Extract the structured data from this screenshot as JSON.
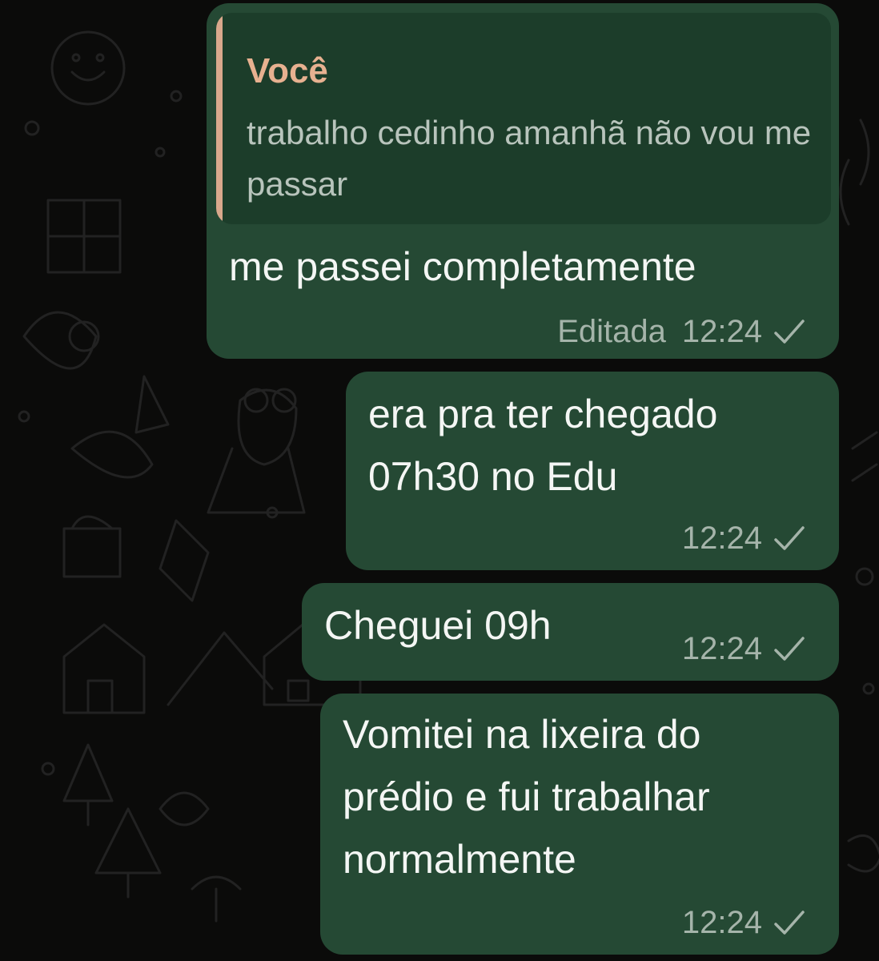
{
  "colors": {
    "background": "#0b0b0a",
    "bubble_outgoing": "#254934",
    "quote_background": "#1c3d2a",
    "quote_accent": "#d9a88c",
    "meta_text": "#a5b4aa"
  },
  "messages": [
    {
      "quote": {
        "author": "Você",
        "text": "trabalho cedinho amanhã não vou me passar"
      },
      "text": "me passei completamente",
      "edited_label": "Editada",
      "time": "12:24",
      "status_icon": "single-check-icon"
    },
    {
      "text": "era pra ter chegado\n07h30 no Edu",
      "time": "12:24",
      "status_icon": "single-check-icon"
    },
    {
      "text": "Cheguei 09h",
      "time": "12:24",
      "status_icon": "single-check-icon"
    },
    {
      "text": "Vomitei na lixeira do\nprédio e fui trabalhar\nnormalmente",
      "time": "12:24",
      "status_icon": "single-check-icon"
    }
  ]
}
